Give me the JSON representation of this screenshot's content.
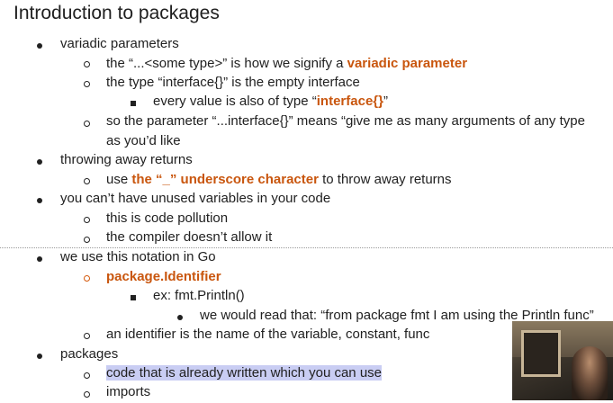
{
  "title": "Introduction to packages",
  "items": [
    {
      "kind": "dot",
      "text": "variadic parameters"
    },
    {
      "kind": "ring",
      "segments": [
        {
          "t": "the “...<some type>” is how we signify a "
        },
        {
          "t": "variadic parameter",
          "em": true
        }
      ]
    },
    {
      "kind": "ring",
      "text": "the type “interface{}” is the empty interface"
    },
    {
      "kind": "square",
      "segments": [
        {
          "t": "every value is also of type “"
        },
        {
          "t": "interface{}",
          "em": true
        },
        {
          "t": "”"
        }
      ]
    },
    {
      "kind": "ring",
      "text": "so the parameter “...interface{}” means “give me as many arguments of any type"
    },
    {
      "kind": "cont",
      "text": "as you’d like"
    },
    {
      "kind": "dot",
      "text": "throwing away returns"
    },
    {
      "kind": "ring",
      "segments": [
        {
          "t": "use "
        },
        {
          "t": "the “_” underscore character",
          "em": true
        },
        {
          "t": " to throw away returns"
        }
      ]
    },
    {
      "kind": "dot",
      "text": "you can’t have unused variables in your code"
    },
    {
      "kind": "ring",
      "text": "this is code pollution"
    },
    {
      "kind": "ring",
      "text": "the compiler doesn’t allow it"
    },
    {
      "kind": "dot",
      "text": "we use this notation in Go"
    },
    {
      "kind": "ring-orange",
      "segments": [
        {
          "t": "package.Identifier",
          "em": true
        }
      ]
    },
    {
      "kind": "square",
      "text": "ex: fmt.Println()"
    },
    {
      "kind": "dot3",
      "text": "we would read that: “from package fmt I am using the Println func”"
    },
    {
      "kind": "ring",
      "text": "an identifier is the name of the variable, constant, func"
    },
    {
      "kind": "dot",
      "text": "packages"
    },
    {
      "kind": "ring",
      "segments": [
        {
          "t": "code that is already written which you can use",
          "hl": true
        }
      ]
    },
    {
      "kind": "ring",
      "text": "imports"
    }
  ]
}
